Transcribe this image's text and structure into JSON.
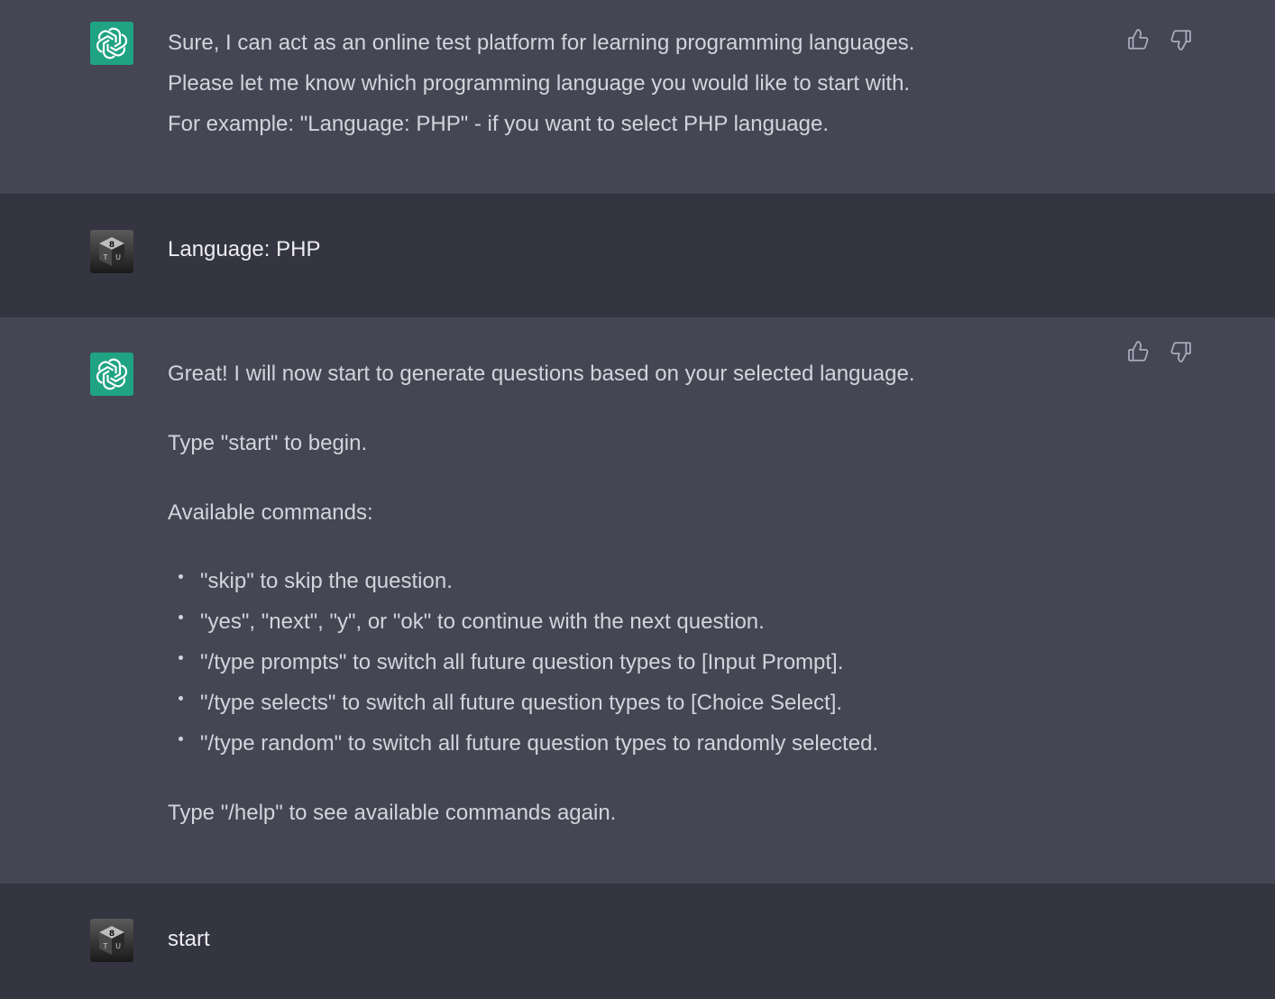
{
  "conversation": [
    {
      "role": "assistant",
      "avatar_icon": "openai-logo-icon",
      "lines": [
        "Sure, I can act as an online test platform for learning programming languages.",
        "Please let me know which programming language you would like to start with.",
        "For example: \"Language: PHP\" - if you want to select PHP language."
      ]
    },
    {
      "role": "user",
      "avatar_icon": "user-avatar-icon",
      "text": "Language: PHP"
    },
    {
      "role": "assistant",
      "avatar_icon": "openai-logo-icon",
      "intro": "Great! I will now start to generate questions based on your selected language.",
      "begin": "Type \"start\" to begin.",
      "commands_heading": "Available commands:",
      "commands": [
        "\"skip\" to skip the question.",
        "\"yes\", \"next\", \"y\", or \"ok\" to continue with the next question.",
        "\"/type prompts\" to switch all future question types to [Input Prompt].",
        "\"/type selects\" to switch all future question types to [Choice Select].",
        "\"/type random\" to switch all future question types to randomly selected."
      ],
      "help": "Type \"/help\" to see available commands again."
    },
    {
      "role": "user",
      "avatar_icon": "user-avatar-icon",
      "text": "start"
    }
  ],
  "feedback_icons": [
    "thumbs-up-icon",
    "thumbs-down-icon"
  ],
  "colors": {
    "assistant_bg": "#444654",
    "user_bg": "#343541",
    "openai_green": "#1fa383",
    "text": "#d1d5db"
  }
}
